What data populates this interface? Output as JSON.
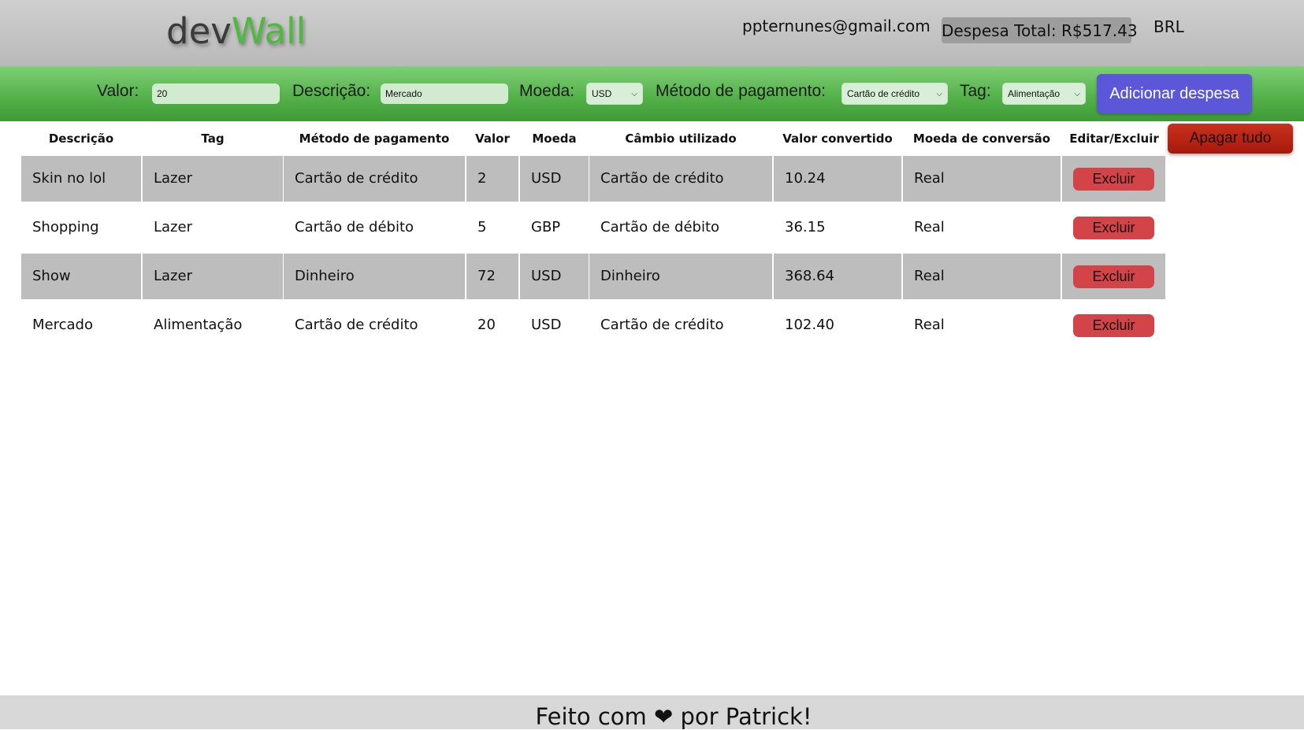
{
  "header": {
    "logo_dev": "dev",
    "logo_wall": "Wall",
    "email": "ppternunes@gmail.com",
    "total_label": "Despesa Total: R$517.43",
    "currency": "BRL"
  },
  "form": {
    "valor_label": "Valor:",
    "valor_value": "20",
    "descricao_label": "Descrição:",
    "descricao_value": "Mercado",
    "moeda_label": "Moeda:",
    "moeda_value": "USD",
    "metodo_label": "Método de pagamento:",
    "metodo_value": "Cartão de crédito",
    "tag_label": "Tag:",
    "tag_value": "Alimentação",
    "add_button": "Adicionar despesa"
  },
  "table": {
    "headers": [
      "Descrição",
      "Tag",
      "Método de pagamento",
      "Valor",
      "Moeda",
      "Câmbio utilizado",
      "Valor convertido",
      "Moeda de conversão",
      "Editar/Excluir"
    ],
    "clear_button": "Apagar tudo",
    "delete_label": "Excluir",
    "rows": [
      [
        "Skin no lol",
        "Lazer",
        "Cartão de crédito",
        "2",
        "USD",
        "Cartão de crédito",
        "10.24",
        "Real"
      ],
      [
        "Shopping",
        "Lazer",
        "Cartão de débito",
        "5",
        "GBP",
        "Cartão de débito",
        "36.15",
        "Real"
      ],
      [
        "Show",
        "Lazer",
        "Dinheiro",
        "72",
        "USD",
        "Dinheiro",
        "368.64",
        "Real"
      ],
      [
        "Mercado",
        "Alimentação",
        "Cartão de crédito",
        "20",
        "USD",
        "Cartão de crédito",
        "102.40",
        "Real"
      ]
    ]
  },
  "footer": {
    "text": "Feito com ❤ por Patrick!"
  },
  "colors": {
    "header_bg": "#c4c4c4",
    "form_bar_green": "#55b24a",
    "add_button": "#5c57d9",
    "clear_button": "#b6220f",
    "delete_button": "#d24448",
    "row_shaded": "#bdbdbd",
    "logo_green": "#4cba3c"
  }
}
